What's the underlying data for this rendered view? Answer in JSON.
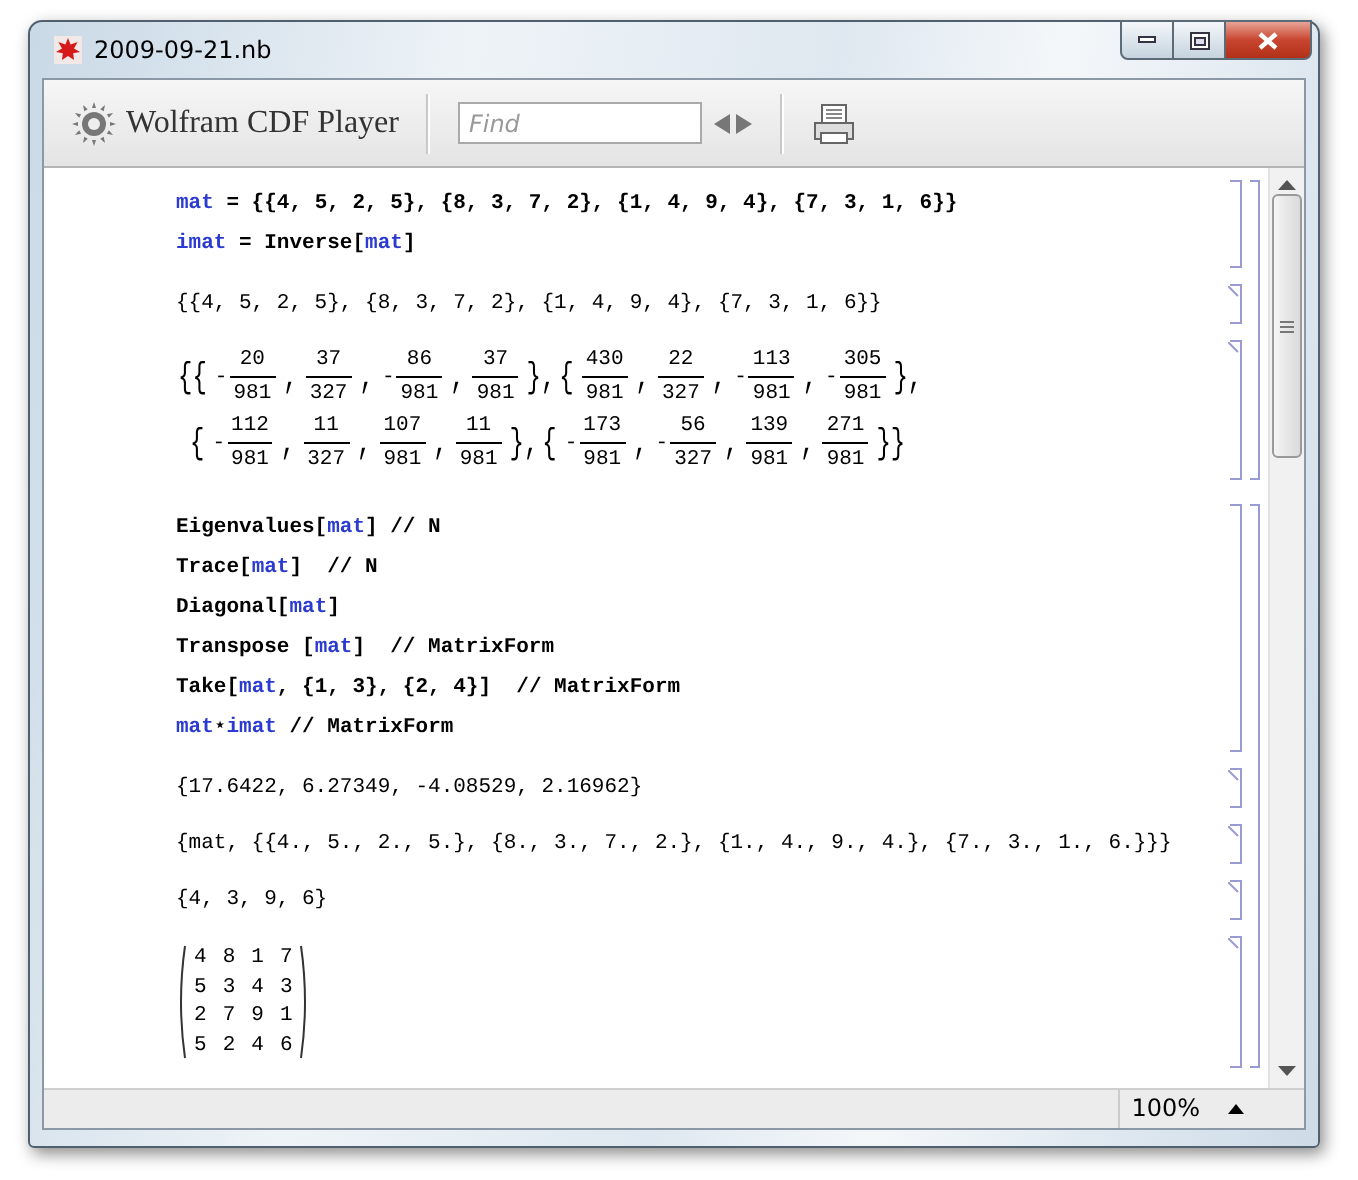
{
  "window": {
    "title": "2009-09-21.nb"
  },
  "toolbar": {
    "app_name": "Wolfram CDF Player",
    "find": {
      "placeholder": "Find"
    }
  },
  "notebook": {
    "groups": [
      {
        "input": {
          "lines": [
            [
              {
                "kind": "symbol",
                "text": "mat"
              },
              {
                "kind": "code",
                "text": " = {{4, 5, 2, 5}, {8, 3, 7, 2}, {1, 4, 9, 4}, {7, 3, 1, 6}}"
              }
            ],
            [
              {
                "kind": "symbol",
                "text": "imat"
              },
              {
                "kind": "code",
                "text": " = Inverse["
              },
              {
                "kind": "symbol",
                "text": "mat"
              },
              {
                "kind": "code",
                "text": "]"
              }
            ]
          ]
        },
        "outputs": [
          {
            "kind": "text",
            "text": "{{4, 5, 2, 5}, {8, 3, 7, 2}, {1, 4, 9, 4}, {7, 3, 1, 6}}"
          },
          {
            "kind": "fractions",
            "rows": [
              [
                {
                  "kind": "punct",
                  "text": "{{"
                },
                {
                  "kind": "frac",
                  "sign": "-",
                  "num": "20",
                  "den": "981"
                },
                {
                  "kind": "punct",
                  "text": ","
                },
                {
                  "kind": "frac",
                  "num": "37",
                  "den": "327"
                },
                {
                  "kind": "punct",
                  "text": ","
                },
                {
                  "kind": "frac",
                  "sign": "-",
                  "num": "86",
                  "den": "981"
                },
                {
                  "kind": "punct",
                  "text": ","
                },
                {
                  "kind": "frac",
                  "num": "37",
                  "den": "981"
                },
                {
                  "kind": "punct",
                  "text": "},"
                },
                {
                  "kind": "punct",
                  "text": "{"
                },
                {
                  "kind": "frac",
                  "num": "430",
                  "den": "981"
                },
                {
                  "kind": "punct",
                  "text": ","
                },
                {
                  "kind": "frac",
                  "num": "22",
                  "den": "327"
                },
                {
                  "kind": "punct",
                  "text": ","
                },
                {
                  "kind": "frac",
                  "sign": "-",
                  "num": "113",
                  "den": "981"
                },
                {
                  "kind": "punct",
                  "text": ","
                },
                {
                  "kind": "frac",
                  "sign": "-",
                  "num": "305",
                  "den": "981"
                },
                {
                  "kind": "punct",
                  "text": "},"
                }
              ],
              [
                {
                  "kind": "punct",
                  "text": "{"
                },
                {
                  "kind": "frac",
                  "sign": "-",
                  "num": "112",
                  "den": "981"
                },
                {
                  "kind": "punct",
                  "text": ","
                },
                {
                  "kind": "frac",
                  "num": "11",
                  "den": "327"
                },
                {
                  "kind": "punct",
                  "text": ","
                },
                {
                  "kind": "frac",
                  "num": "107",
                  "den": "981"
                },
                {
                  "kind": "punct",
                  "text": ","
                },
                {
                  "kind": "frac",
                  "num": "11",
                  "den": "981"
                },
                {
                  "kind": "punct",
                  "text": "},"
                },
                {
                  "kind": "punct",
                  "text": "{"
                },
                {
                  "kind": "frac",
                  "sign": "-",
                  "num": "173",
                  "den": "981"
                },
                {
                  "kind": "punct",
                  "text": ","
                },
                {
                  "kind": "frac",
                  "sign": "-",
                  "num": "56",
                  "den": "327"
                },
                {
                  "kind": "punct",
                  "text": ","
                },
                {
                  "kind": "frac",
                  "num": "139",
                  "den": "981"
                },
                {
                  "kind": "punct",
                  "text": ","
                },
                {
                  "kind": "frac",
                  "num": "271",
                  "den": "981"
                },
                {
                  "kind": "punct",
                  "text": "}}"
                }
              ]
            ]
          }
        ]
      },
      {
        "input": {
          "lines": [
            [
              {
                "kind": "code",
                "text": "Eigenvalues["
              },
              {
                "kind": "symbol",
                "text": "mat"
              },
              {
                "kind": "code",
                "text": "] // N"
              }
            ],
            [
              {
                "kind": "code",
                "text": "Trace["
              },
              {
                "kind": "symbol",
                "text": "mat"
              },
              {
                "kind": "code",
                "text": "]  // N"
              }
            ],
            [
              {
                "kind": "code",
                "text": "Diagonal["
              },
              {
                "kind": "symbol",
                "text": "mat"
              },
              {
                "kind": "code",
                "text": "]"
              }
            ],
            [
              {
                "kind": "code",
                "text": "Transpose ["
              },
              {
                "kind": "symbol",
                "text": "mat"
              },
              {
                "kind": "code",
                "text": "]  // MatrixForm"
              }
            ],
            [
              {
                "kind": "code",
                "text": "Take["
              },
              {
                "kind": "symbol",
                "text": "mat"
              },
              {
                "kind": "code",
                "text": ", {1, 3}, {2, 4}]  // MatrixForm"
              }
            ],
            [
              {
                "kind": "symbol",
                "text": "mat"
              },
              {
                "kind": "code",
                "text": "⋆"
              },
              {
                "kind": "symbol",
                "text": "imat"
              },
              {
                "kind": "code",
                "text": " // MatrixForm"
              }
            ]
          ]
        },
        "outputs": [
          {
            "kind": "text",
            "text": "{17.6422, 6.27349, -4.08529, 2.16962}"
          },
          {
            "kind": "text",
            "text": "{mat, {{4., 5., 2., 5.}, {8., 3., 7., 2.}, {1., 4., 9., 4.}, {7., 3., 1., 6.}}}"
          },
          {
            "kind": "text",
            "text": "{4, 3, 9, 6}"
          },
          {
            "kind": "matrix",
            "rows": [
              [
                "4",
                "8",
                "1",
                "7"
              ],
              [
                "5",
                "3",
                "4",
                "3"
              ],
              [
                "2",
                "7",
                "9",
                "1"
              ],
              [
                "5",
                "2",
                "4",
                "6"
              ]
            ]
          }
        ]
      }
    ]
  },
  "status_bar": {
    "zoom": "100%"
  }
}
